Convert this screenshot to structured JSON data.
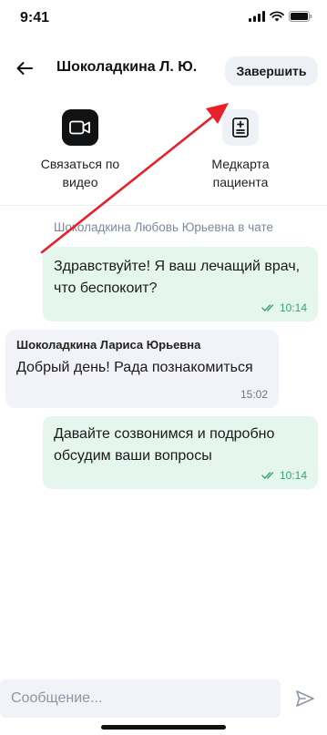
{
  "status_bar": {
    "time": "9:41"
  },
  "header": {
    "title": "Шоколадкина Л. Ю.",
    "finish_label": "Завершить"
  },
  "actions": {
    "video": {
      "label": "Связаться по видео",
      "icon": "video-camera-icon"
    },
    "medcard": {
      "label": "Медкарта пациента",
      "icon": "medical-record-icon"
    }
  },
  "chat": {
    "notice": "Шоколадкина Любовь Юрьевна в чате",
    "messages": [
      {
        "direction": "outgoing",
        "text": "Здравствуйте! Я ваш лечащий врач, что беспокоит?",
        "time": "10:14",
        "read": true
      },
      {
        "direction": "incoming",
        "sender": "Шоколадкина Лариса Юрьевна",
        "text": "Добрый день! Рада познакомиться",
        "time": "15:02"
      },
      {
        "direction": "outgoing",
        "text": "Давайте созвонимся и подробно обсудим ваши вопросы",
        "time": "10:14",
        "read": true
      }
    ]
  },
  "composer": {
    "placeholder": "Сообщение..."
  },
  "colors": {
    "outgoing_bubble": "#e5f6ee",
    "incoming_bubble": "#f2f3f8",
    "read_check": "#3aa370",
    "annotation_arrow": "#e8202a",
    "notice_text": "#7a8aa0"
  }
}
